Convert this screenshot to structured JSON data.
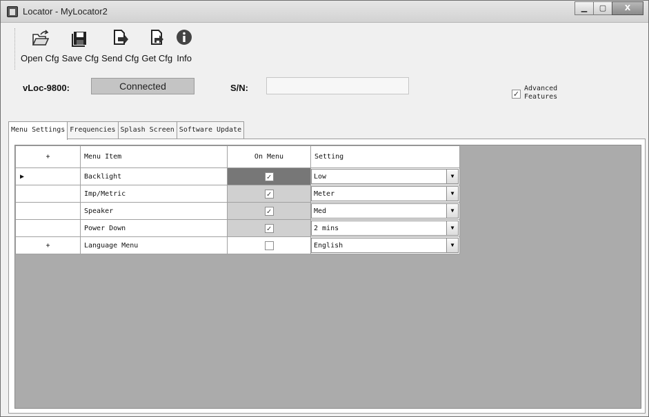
{
  "window": {
    "title": "Locator - MyLocator2",
    "controls": {
      "minimize": "▁",
      "maximize": "▢",
      "close": "X"
    }
  },
  "toolbar": {
    "items": [
      {
        "label": "Open Cfg",
        "icon": "open-folder-icon"
      },
      {
        "label": "Save Cfg",
        "icon": "save-icon"
      },
      {
        "label": "Send Cfg",
        "icon": "send-document-icon"
      },
      {
        "label": "Get Cfg",
        "icon": "get-document-icon"
      },
      {
        "label": "Info",
        "icon": "info-icon"
      }
    ]
  },
  "device": {
    "model_label": "vLoc-9800:",
    "status": "Connected",
    "sn_label": "S/N:",
    "sn_value": ""
  },
  "advanced": {
    "label": "Advanced\nFeatures",
    "checked": true,
    "check_glyph": "✓"
  },
  "tabs": [
    {
      "label": "Menu Settings",
      "active": true
    },
    {
      "label": "Frequencies",
      "active": false
    },
    {
      "label": "Splash Screen",
      "active": false
    },
    {
      "label": "Software Update",
      "active": false
    }
  ],
  "grid": {
    "headers": {
      "expand": "+",
      "item": "Menu Item",
      "on_menu": "On Menu",
      "setting": "Setting"
    },
    "rows": [
      {
        "indicator": "▶",
        "item": "Backlight",
        "on_menu": true,
        "setting": "Low",
        "selected": true
      },
      {
        "indicator": "",
        "item": "Imp/Metric",
        "on_menu": true,
        "setting": "Meter",
        "selected": false
      },
      {
        "indicator": "",
        "item": "Speaker",
        "on_menu": true,
        "setting": "Med",
        "selected": false
      },
      {
        "indicator": "",
        "item": "Power Down",
        "on_menu": true,
        "setting": "2 mins",
        "selected": false
      },
      {
        "indicator": "+",
        "item": "Language Menu",
        "on_menu": false,
        "setting": "English",
        "selected": false
      }
    ],
    "dropdown_glyph": "▼",
    "check_glyph": "✓"
  },
  "colors": {
    "grid_background": "#ababab",
    "status_background": "#c4c4c4",
    "selected_cell": "#777777"
  }
}
